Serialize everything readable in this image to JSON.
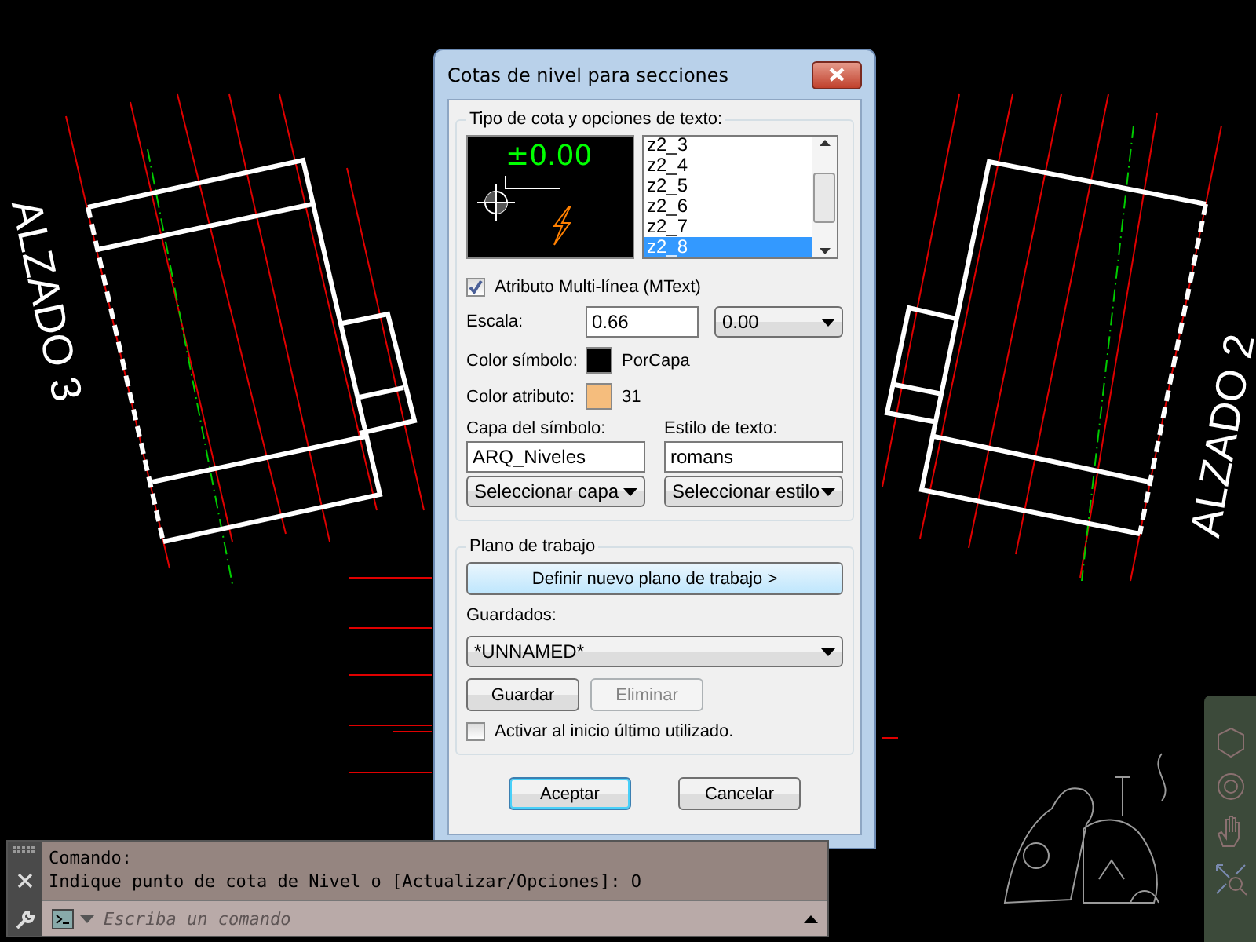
{
  "canvas": {
    "labels": [
      {
        "text": "ALZADO 3"
      },
      {
        "text": "ALZADO 2"
      }
    ]
  },
  "dialog": {
    "title": "Cotas de nivel para secciones",
    "type_group": {
      "legend": "Tipo de cota y opciones de texto:",
      "preview_text": "±0.00",
      "list": [
        {
          "label": "z2_3",
          "selected": false
        },
        {
          "label": "z2_4",
          "selected": false
        },
        {
          "label": "z2_5",
          "selected": false
        },
        {
          "label": "z2_6",
          "selected": false
        },
        {
          "label": "z2_7",
          "selected": false
        },
        {
          "label": "z2_8",
          "selected": true
        }
      ],
      "mtext": {
        "label": "Atributo Multi-línea (MText)",
        "checked": true
      },
      "scale": {
        "label": "Escala:",
        "value": "0.66",
        "precision": "0.00"
      },
      "symbol_color": {
        "label": "Color símbolo:",
        "color": "#000000",
        "value": "PorCapa"
      },
      "attribute_color": {
        "label": "Color atributo:",
        "color": "#f5bd7d",
        "value": "31"
      },
      "layer": {
        "label": "Capa del símbolo:",
        "value": "ARQ_Niveles",
        "button": "Seleccionar capa"
      },
      "style": {
        "label": "Estilo de texto:",
        "value": "romans",
        "button": "Seleccionar estilo"
      }
    },
    "plane_group": {
      "legend": "Plano de trabajo",
      "define_button": "Definir nuevo plano de trabajo >",
      "saved_label": "Guardados:",
      "saved_value": "*UNNAMED*",
      "buttons": [
        {
          "label": "Guardar",
          "disabled": false
        },
        {
          "label": "Eliminar",
          "disabled": true
        }
      ],
      "activate": {
        "label": "Activar al inicio último utilizado.",
        "checked": false
      }
    },
    "buttons": [
      {
        "label": "Aceptar",
        "default": true
      },
      {
        "label": "Cancelar",
        "default": false
      }
    ]
  },
  "command_line": {
    "history": [
      "Comando:",
      "Indique punto de cota de Nivel o [Actualizar/Opciones]: O"
    ],
    "placeholder": "Escriba un comando"
  }
}
